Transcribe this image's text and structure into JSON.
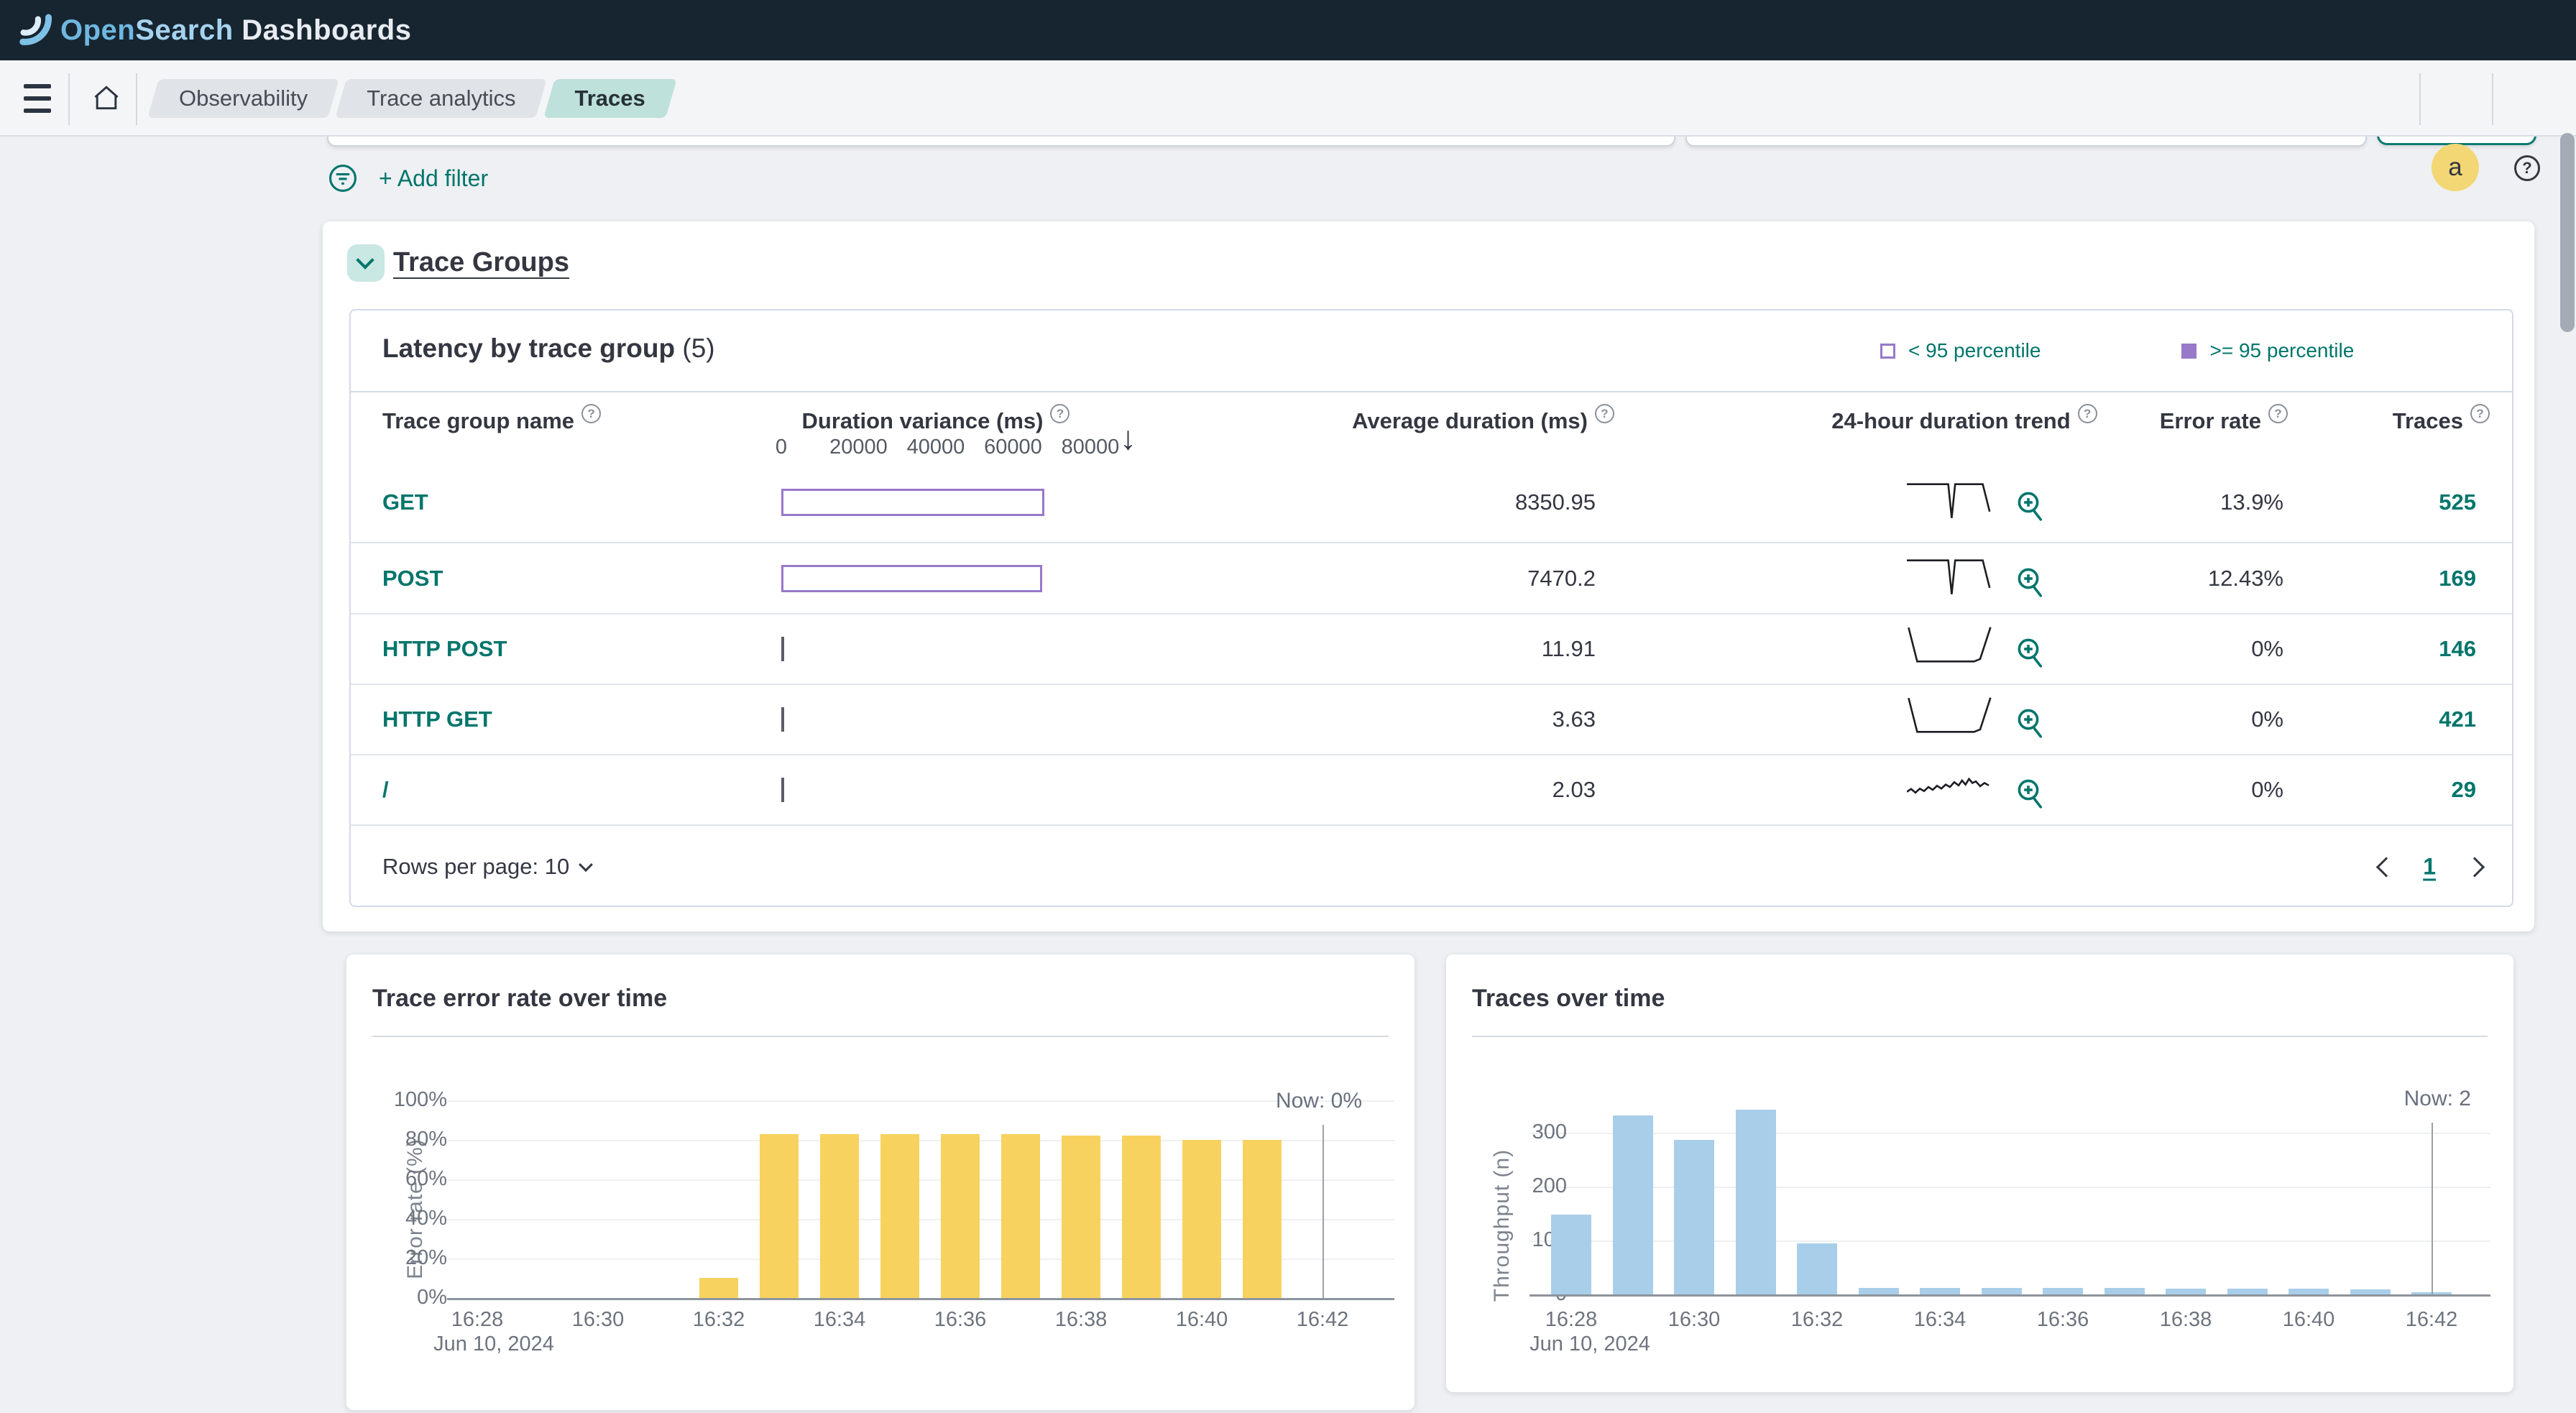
{
  "header": {
    "brand_open": "Open",
    "brand_search": "Search",
    "brand_rest": " Dashboards"
  },
  "nav": {
    "breadcrumbs": [
      {
        "label": "Observability",
        "active": false
      },
      {
        "label": "Trace analytics",
        "active": false
      },
      {
        "label": "Traces",
        "active": true
      }
    ],
    "avatar_letter": "a"
  },
  "filter_bar": {
    "add_filter_label": "+ Add filter"
  },
  "trace_groups": {
    "title": "Trace Groups"
  },
  "table": {
    "panel_title": "Latency by trace group",
    "panel_count": "(5)",
    "legend": [
      {
        "label": "< 95 percentile",
        "filled": false
      },
      {
        "label": ">= 95 percentile",
        "filled": true
      }
    ],
    "columns": {
      "name": "Trace group name",
      "variance": "Duration variance (ms)",
      "avg": "Average duration (ms)",
      "trend": "24-hour duration trend",
      "error": "Error rate",
      "traces": "Traces"
    },
    "variance_axis": {
      "ticks": [
        "0",
        "20000",
        "40000",
        "60000",
        "80000"
      ],
      "max": 80000
    },
    "rows": [
      {
        "name": "GET",
        "variance_ms": 68000,
        "avg_duration": "8350.95",
        "trend": "notch",
        "error_rate": "13.9%",
        "traces": "525"
      },
      {
        "name": "POST",
        "variance_ms": 67600,
        "avg_duration": "7470.2",
        "trend": "notch",
        "error_rate": "12.43%",
        "traces": "169"
      },
      {
        "name": "HTTP POST",
        "variance_ms": 600,
        "avg_duration": "11.91",
        "trend": "tub",
        "error_rate": "0%",
        "traces": "146"
      },
      {
        "name": "HTTP GET",
        "variance_ms": 600,
        "avg_duration": "3.63",
        "trend": "tub",
        "error_rate": "0%",
        "traces": "421"
      },
      {
        "name": "/",
        "variance_ms": 600,
        "avg_duration": "2.03",
        "trend": "noisy",
        "error_rate": "0%",
        "traces": "29"
      }
    ],
    "footer": {
      "rows_per_page_label": "Rows per page: 10",
      "page": "1"
    }
  },
  "sparklines": {
    "notch": [
      [
        0,
        12
      ],
      [
        44,
        12
      ],
      [
        48,
        12
      ],
      [
        52,
        96
      ],
      [
        56,
        12
      ],
      [
        88,
        12
      ],
      [
        96,
        80
      ]
    ],
    "tub": [
      [
        2,
        4
      ],
      [
        12,
        88
      ],
      [
        78,
        88
      ],
      [
        85,
        82
      ],
      [
        97,
        3
      ]
    ],
    "noisy": [
      [
        0,
        62
      ],
      [
        5,
        55
      ],
      [
        10,
        64
      ],
      [
        15,
        54
      ],
      [
        20,
        60
      ],
      [
        25,
        50
      ],
      [
        30,
        57
      ],
      [
        35,
        47
      ],
      [
        40,
        54
      ],
      [
        45,
        44
      ],
      [
        50,
        50
      ],
      [
        55,
        38
      ],
      [
        60,
        46
      ],
      [
        64,
        34
      ],
      [
        68,
        44
      ],
      [
        72,
        30
      ],
      [
        76,
        40
      ],
      [
        80,
        36
      ],
      [
        85,
        48
      ],
      [
        90,
        40
      ],
      [
        95,
        46
      ]
    ]
  },
  "chart_data": [
    {
      "type": "bar",
      "title": "Trace error rate over time",
      "ylabel": "Error rate (%)",
      "categories": [
        "16:28",
        "16:29",
        "16:30",
        "16:31",
        "16:32",
        "16:33",
        "16:34",
        "16:35",
        "16:36",
        "16:37",
        "16:38",
        "16:39",
        "16:40",
        "16:41",
        "16:42"
      ],
      "values": [
        0,
        0,
        0,
        0,
        10,
        83,
        83,
        83,
        83,
        83,
        82,
        82,
        80,
        80,
        0
      ],
      "yticks": [
        0,
        20,
        40,
        60,
        80,
        100
      ],
      "ytick_suffix": "%",
      "ylim": [
        0,
        104
      ],
      "grid": true,
      "legend_position": "none",
      "x_date": "Jun 10, 2024",
      "now": {
        "category": "16:42",
        "label": "Now: 0%"
      },
      "bar_color": "#f7d25f"
    },
    {
      "type": "bar",
      "title": "Traces over time",
      "ylabel": "Throughput (n)",
      "categories": [
        "16:28",
        "16:29",
        "16:30",
        "16:31",
        "16:32",
        "16:33",
        "16:34",
        "16:35",
        "16:36",
        "16:37",
        "16:38",
        "16:39",
        "16:40",
        "16:41",
        "16:42"
      ],
      "values": [
        148,
        332,
        287,
        343,
        95,
        12,
        12,
        12,
        12,
        12,
        11,
        11,
        10,
        9,
        2
      ],
      "yticks": [
        0,
        100,
        200,
        300
      ],
      "ytick_suffix": "",
      "ylim": [
        0,
        360
      ],
      "grid": true,
      "legend_position": "none",
      "x_date": "Jun 10, 2024",
      "now": {
        "category": "16:42",
        "label": "Now: 2"
      },
      "bar_color": "#a9cee9"
    }
  ],
  "colors": {
    "accent": "#00756b",
    "purple": "#9878c9",
    "yellow": "#f7d25f",
    "blue": "#a9cee9",
    "header_bg": "#172530",
    "avatar_bg": "#f2d774",
    "spark_stroke": "#1d1e24"
  }
}
